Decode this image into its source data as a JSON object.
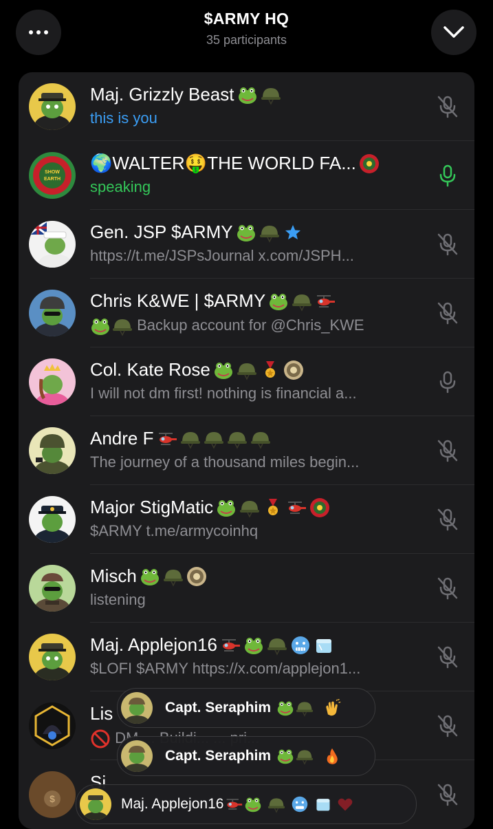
{
  "header": {
    "title": "$ARMY HQ",
    "subtitle": "35 participants",
    "menu_icon": "more-dots-icon",
    "collapse_icon": "chevron-down-icon"
  },
  "participants": [
    {
      "name": "Maj. Grizzly Beast",
      "status": "this is you",
      "mic": "muted",
      "emoji": [
        "frog",
        "helmet"
      ]
    },
    {
      "name": "🌍WALTER🤑THE WORLD FA...",
      "status": "speaking",
      "mic": "active",
      "emoji": [
        "badge"
      ]
    },
    {
      "name": "Gen. JSP $ARMY",
      "status": "https://t.me/JSPsJournal x.com/JSPH...",
      "mic": "muted",
      "emoji": [
        "frog",
        "helmet",
        "star"
      ]
    },
    {
      "name": "Chris K&WE | $ARMY",
      "status": "Backup account for @Chris_KWE",
      "status_emoji": [
        "frog",
        "helmet"
      ],
      "mic": "muted",
      "emoji": [
        "frog",
        "helmet",
        "helicopter"
      ]
    },
    {
      "name": "Col. Kate Rose",
      "status": "I will not dm first! nothing is financial a...",
      "mic": "unmuted",
      "emoji": [
        "frog",
        "helmet",
        "medal",
        "badge"
      ]
    },
    {
      "name": "Andre F",
      "status": "The journey of a thousand miles begin...",
      "mic": "muted",
      "emoji": [
        "helicopter",
        "helmet",
        "helmet",
        "helmet",
        "helmet"
      ]
    },
    {
      "name": "Major StigMatic",
      "status": "$ARMY t.me/armycoinhq",
      "mic": "muted",
      "emoji": [
        "frog",
        "helmet",
        "medal",
        "helicopter",
        "badge"
      ]
    },
    {
      "name": "Misch",
      "status": "listening",
      "mic": "muted",
      "emoji": [
        "frog",
        "helmet",
        "badge"
      ]
    },
    {
      "name": "Maj. Applejon16",
      "status": "$LOFI $ARMY https://x.com/applejon1...",
      "mic": "muted",
      "emoji": [
        "helicopter",
        "frog",
        "helmet",
        "cold-face",
        "ice"
      ]
    },
    {
      "name": "Lis",
      "status": "DM ... Buildi... ... pri...",
      "status_emoji": [
        "no-entry"
      ],
      "mic": "muted",
      "emoji": []
    },
    {
      "name": "Si",
      "status": "",
      "mic": "muted",
      "emoji": []
    }
  ],
  "reaction_toasts": [
    {
      "name": "Capt. Seraphim",
      "emoji": [
        "frog",
        "helmet",
        "clap"
      ]
    },
    {
      "name": "Capt. Seraphim",
      "emoji": [
        "frog",
        "helmet",
        "fire"
      ]
    },
    {
      "name": "Maj. Applejon16",
      "emoji": [
        "helicopter",
        "frog",
        "helmet",
        "cold-face",
        "ice",
        "heart"
      ]
    }
  ],
  "colors": {
    "background": "#000000",
    "panel": "#1c1c1e",
    "you_label": "#3b9ef5",
    "speaking": "#34c759",
    "muted_text": "#8e8e93"
  }
}
